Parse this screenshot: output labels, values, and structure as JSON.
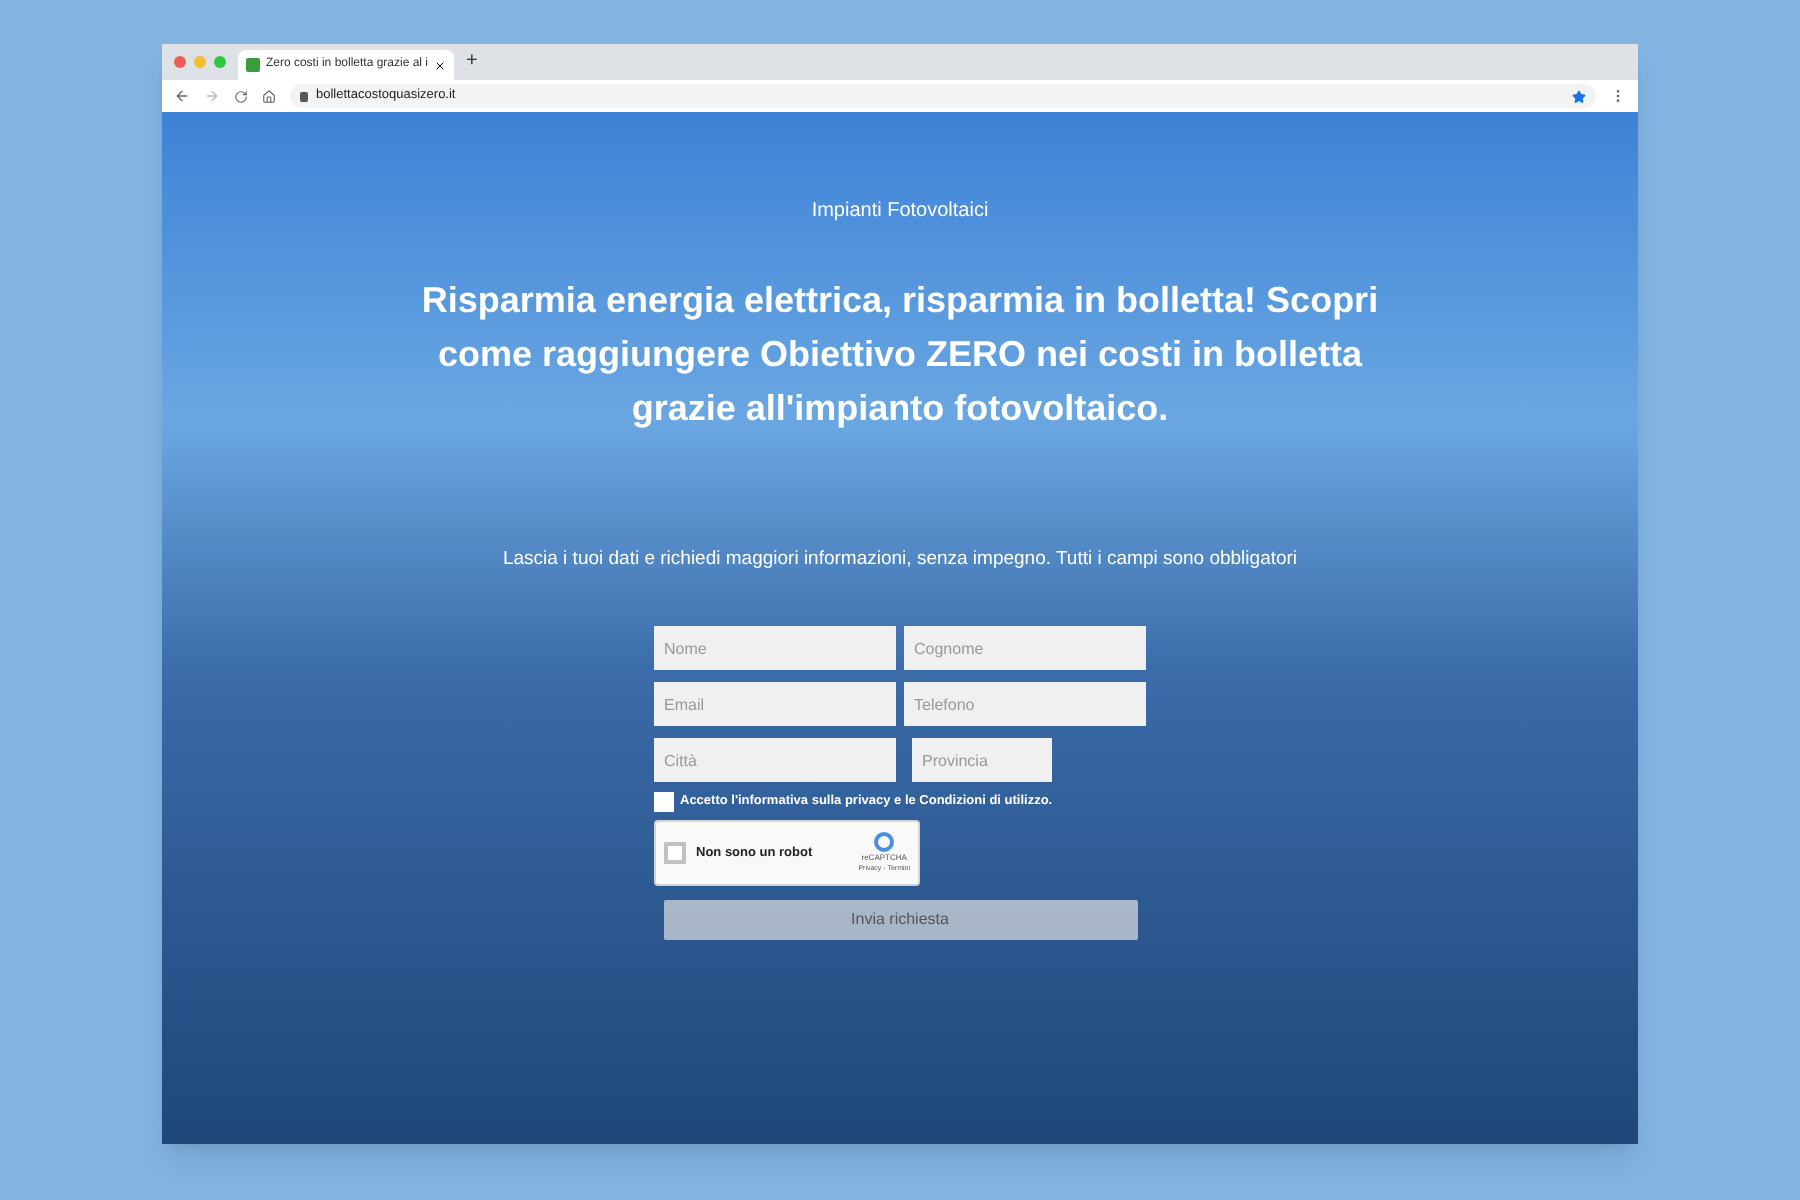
{
  "browser": {
    "tab_title": "Zero costi in bolletta grazie al i",
    "new_tab": "+",
    "url": "bollettacostoquasizero.it"
  },
  "page": {
    "eyebrow": "Impianti Fotovoltaici",
    "headline": "Risparmia energia elettrica, risparmia in bolletta! Scopri come raggiungere Obiettivo ZERO nei costi in bolletta grazie all'impianto fotovoltaico.",
    "intro": "Lascia i tuoi dati e richiedi maggiori informazioni, senza impegno. Tutti i campi sono obbligatori"
  },
  "form": {
    "fields": [
      {
        "placeholder": "Nome",
        "kind": "wide"
      },
      {
        "placeholder": "Cognome",
        "kind": "wide"
      },
      {
        "placeholder": "Email",
        "kind": "wide"
      },
      {
        "placeholder": "Telefono",
        "kind": "wide"
      },
      {
        "placeholder": "Città",
        "kind": "wide"
      },
      {
        "placeholder": "Provincia",
        "kind": "narrow"
      }
    ],
    "consent": {
      "label": "Accetto l'informativa sulla privacy e le Condizioni di utilizzo.",
      "checked": false
    },
    "captcha": {
      "label": "Non sono un robot",
      "brand": "reCAPTCHA",
      "links": "Privacy - Termini",
      "checked": false
    },
    "submit": "Invia richiesta"
  }
}
